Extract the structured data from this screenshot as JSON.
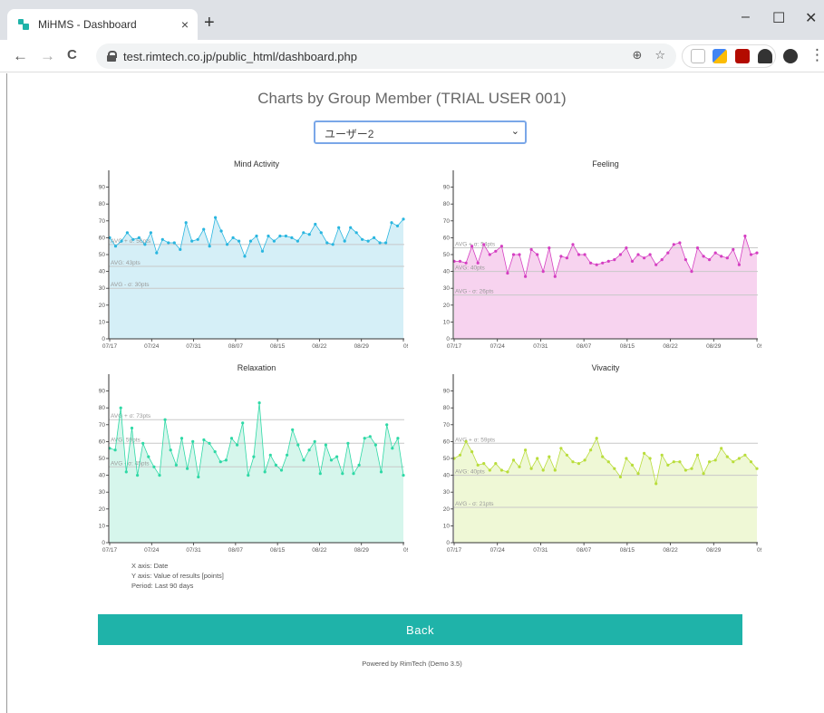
{
  "browser": {
    "tab_title": "MiHMS - Dashboard",
    "tab_close": "×",
    "new_tab": "+",
    "minimize": "–",
    "maximize": "☐",
    "close": "✕",
    "url": "test.rimtech.co.jp/public_html/dashboard.php",
    "back": "←",
    "forward": "→",
    "reload": "C",
    "zoom": "⊕",
    "star": "☆",
    "menu": "⋮"
  },
  "page": {
    "title": "Charts by Group Member (TRIAL USER 001)",
    "selected_user": "ユーザー2",
    "info_x": "X axis: Date",
    "info_y": "Y axis: Value of results [points]",
    "info_period": "Period: Last 90 days",
    "back_label": "Back",
    "footer": "Powered by RimTech (Demo 3.5)"
  },
  "chart_data": [
    {
      "type": "area",
      "title": "Mind Activity",
      "color": "#29b6e0",
      "fill": "#d5eff7",
      "ylim": [
        0,
        100
      ],
      "yticks": [
        0,
        10,
        20,
        30,
        40,
        50,
        60,
        70,
        80,
        90
      ],
      "xticks": [
        "07/17",
        "07/24",
        "07/31",
        "08/07",
        "08/15",
        "08/22",
        "08/29",
        "09/("
      ],
      "avg_lines": [
        {
          "label": "AVG + σ: 56pts",
          "value": 56
        },
        {
          "label": "AVG: 43pts",
          "value": 43
        },
        {
          "label": "AVG - σ: 30pts",
          "value": 30
        }
      ],
      "values": [
        60,
        55,
        58,
        63,
        59,
        60,
        56,
        63,
        51,
        59,
        57,
        57,
        53,
        69,
        58,
        59,
        65,
        55,
        72,
        64,
        56,
        60,
        58,
        49,
        58,
        61,
        52,
        61,
        58,
        61,
        61,
        60,
        58,
        63,
        62,
        68,
        63,
        57,
        56,
        66,
        58,
        66,
        63,
        59,
        58,
        60,
        57,
        57,
        69,
        67,
        71
      ]
    },
    {
      "type": "area",
      "title": "Feeling",
      "color": "#d53fc2",
      "fill": "#f7d3ef",
      "ylim": [
        0,
        100
      ],
      "yticks": [
        0,
        10,
        20,
        30,
        40,
        50,
        60,
        70,
        80,
        90
      ],
      "xticks": [
        "07/17",
        "07/24",
        "07/31",
        "08/07",
        "08/15",
        "08/22",
        "08/29",
        "09/("
      ],
      "avg_lines": [
        {
          "label": "AVG + σ: 54pts",
          "value": 54
        },
        {
          "label": "AVG: 40pts",
          "value": 40
        },
        {
          "label": "AVG - σ: 26pts",
          "value": 26
        }
      ],
      "values": [
        46,
        46,
        45,
        55,
        45,
        56,
        50,
        52,
        55,
        39,
        50,
        50,
        37,
        53,
        50,
        40,
        54,
        37,
        49,
        48,
        56,
        50,
        50,
        45,
        44,
        45,
        46,
        47,
        50,
        54,
        46,
        50,
        48,
        50,
        44,
        47,
        51,
        56,
        57,
        47,
        40,
        54,
        49,
        47,
        51,
        49,
        48,
        53,
        44,
        61,
        50,
        51
      ]
    },
    {
      "type": "area",
      "title": "Relaxation",
      "color": "#2fd9a6",
      "fill": "#d6f6ec",
      "ylim": [
        0,
        100
      ],
      "yticks": [
        0,
        10,
        20,
        30,
        40,
        50,
        60,
        70,
        80,
        90
      ],
      "xticks": [
        "07/17",
        "07/24",
        "07/31",
        "08/07",
        "08/15",
        "08/22",
        "08/29",
        "09/("
      ],
      "avg_lines": [
        {
          "label": "AVG + σ: 73pts",
          "value": 73
        },
        {
          "label": "AVG: 59pts",
          "value": 59
        },
        {
          "label": "AVG - σ: 45pts",
          "value": 45
        }
      ],
      "values": [
        56,
        55,
        80,
        42,
        68,
        40,
        59,
        51,
        45,
        40,
        73,
        55,
        46,
        62,
        44,
        60,
        39,
        61,
        59,
        54,
        48,
        49,
        62,
        58,
        71,
        40,
        51,
        83,
        42,
        52,
        46,
        43,
        52,
        67,
        58,
        49,
        55,
        60,
        41,
        58,
        49,
        51,
        41,
        59,
        41,
        46,
        62,
        63,
        58,
        42,
        70,
        56,
        62,
        40
      ]
    },
    {
      "type": "area",
      "title": "Vivacity",
      "color": "#b9dd3b",
      "fill": "#eff8d6",
      "ylim": [
        0,
        100
      ],
      "yticks": [
        0,
        10,
        20,
        30,
        40,
        50,
        60,
        70,
        80,
        90
      ],
      "xticks": [
        "07/17",
        "07/24",
        "07/31",
        "08/07",
        "08/15",
        "08/22",
        "08/29",
        "09/("
      ],
      "avg_lines": [
        {
          "label": "AVG + σ: 59pts",
          "value": 59
        },
        {
          "label": "AVG: 40pts",
          "value": 40
        },
        {
          "label": "AVG - σ: 21pts",
          "value": 21
        }
      ],
      "values": [
        50,
        52,
        60,
        54,
        46,
        47,
        43,
        47,
        43,
        42,
        49,
        45,
        55,
        44,
        50,
        43,
        51,
        43,
        56,
        52,
        48,
        47,
        49,
        55,
        62,
        51,
        48,
        44,
        39,
        50,
        46,
        41,
        53,
        50,
        35,
        52,
        46,
        48,
        48,
        43,
        44,
        52,
        41,
        48,
        49,
        56,
        51,
        48,
        50,
        52,
        48,
        44
      ]
    }
  ]
}
